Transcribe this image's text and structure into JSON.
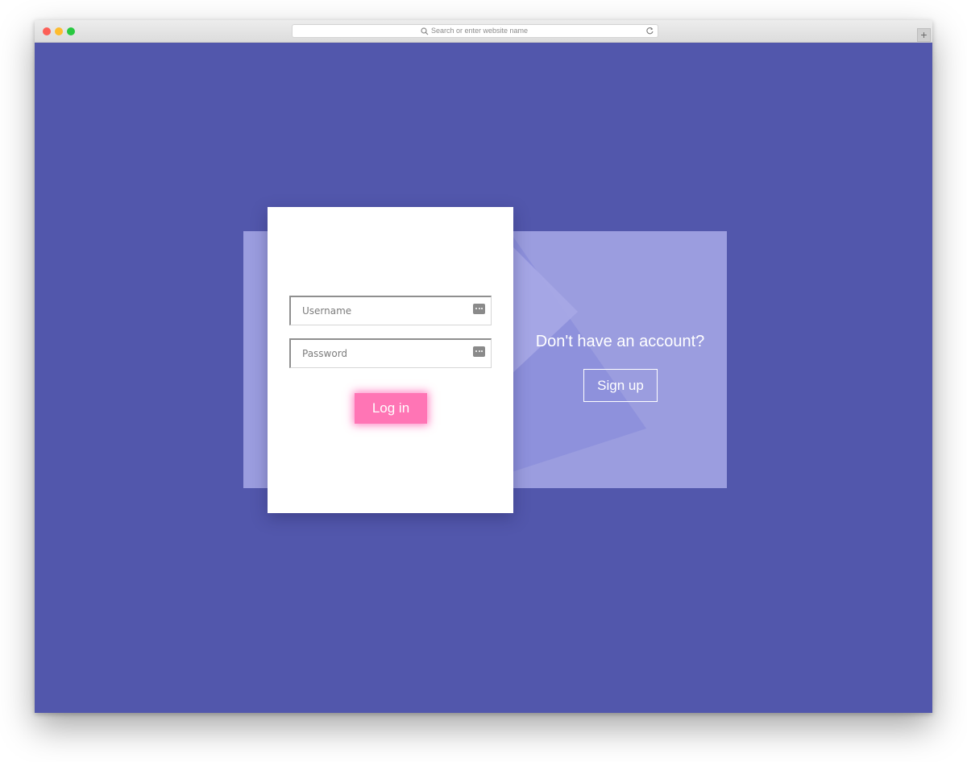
{
  "browser": {
    "address_placeholder": "Search or enter website name",
    "new_tab_label": "+"
  },
  "login_form": {
    "username_placeholder": "Username",
    "password_placeholder": "Password",
    "login_label": "Log in"
  },
  "signup_panel": {
    "title": "Don't have an account?",
    "signup_label": "Sign up"
  },
  "colors": {
    "background": "#5257ac",
    "panel": "#9b9ddf",
    "login_button": "#ff75b5"
  },
  "icons": [
    "search-icon",
    "reload-icon",
    "password-key-icon"
  ]
}
